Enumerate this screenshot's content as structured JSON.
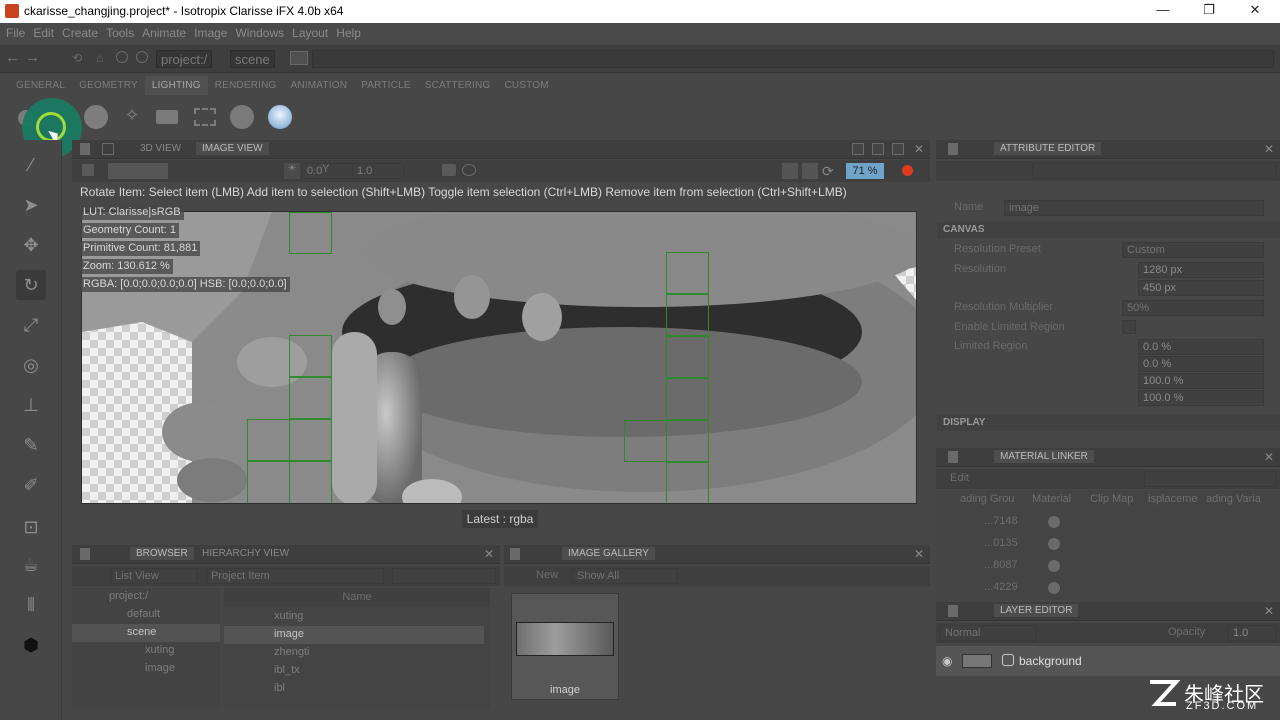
{
  "window": {
    "title": "ckarisse_changjing.project* - Isotropix Clarisse iFX 4.0b x64",
    "min": "—",
    "max": "❐",
    "close": "✕"
  },
  "menu": [
    "File",
    "Edit",
    "Create",
    "Tools",
    "Animate",
    "Image",
    "Windows",
    "Layout",
    "Help"
  ],
  "breadcrumbs": [
    "project:/",
    "scene"
  ],
  "shelf_tabs": [
    "GENERAL",
    "GEOMETRY",
    "LIGHTING",
    "RENDERING",
    "ANIMATION",
    "PARTICLE",
    "SCATTERING",
    "CUSTOM"
  ],
  "viewport": {
    "tabs": [
      "3D VIEW",
      "IMAGE VIEW"
    ],
    "exposure": "0.0",
    "gamma": "1.0",
    "zoom_badge": "71 %",
    "status": "Rotate Item: Select item (LMB)  Add item to selection (Shift+LMB)  Toggle item selection (Ctrl+LMB)  Remove item from selection (Ctrl+Shift+LMB)",
    "info": {
      "lut": "LUT: Clarisse|sRGB",
      "geo": "Geometry Count: 1",
      "prim": "Primitive Count: 81,881",
      "zoom": "Zoom: 130.612 %",
      "rgba": "RGBA: [0.0;0.0;0.0;0.0] HSB: [0.0;0.0;0.0]"
    },
    "caption": "Latest : rgba"
  },
  "browser": {
    "tabs": [
      "BROWSER",
      "HIERARCHY VIEW"
    ],
    "list_view": "List View",
    "filter": "Project Item",
    "column": "Name",
    "tree": [
      "project:/",
      "default",
      "scene",
      "xuting",
      "image"
    ],
    "items": [
      "xuting",
      "image",
      "zhengti",
      "ibl_tx",
      "ibl"
    ]
  },
  "gallery": {
    "tab": "IMAGE GALLERY",
    "new": "New",
    "show": "Show All",
    "thumb_label": "image"
  },
  "attribute_editor": {
    "tab": "ATTRIBUTE EDITOR",
    "name_label": "Name",
    "name_value": "image",
    "section_canvas": "CANVAS",
    "res_preset_label": "Resolution Preset",
    "res_preset": "Custom",
    "resolution_label": "Resolution",
    "res_x": "1280 px",
    "res_y": "450 px",
    "multiplier_label": "Resolution Multiplier",
    "multiplier": "50%",
    "enable_limited_label": "Enable Limited Region",
    "limited_label": "Limited Region",
    "lr": [
      "0.0 %",
      "0.0 %",
      "100.0 %",
      "100.0 %"
    ],
    "section_display": "DISPLAY"
  },
  "material_linker": {
    "tab": "MATERIAL LINKER",
    "edit": "Edit",
    "cols": [
      "ading Grou",
      "Material",
      "Clip Map",
      "isplaceme",
      "ading Varia"
    ],
    "rows": [
      "...7148",
      "...0135",
      "...8087",
      "...4229"
    ]
  },
  "layer_editor": {
    "tab": "LAYER EDITOR",
    "blend": "Normal",
    "opacity_label": "Opacity",
    "opacity": "1.0",
    "layer": "background"
  },
  "watermark": {
    "brand": "朱峰社区",
    "url": "ZF3D.COM"
  }
}
